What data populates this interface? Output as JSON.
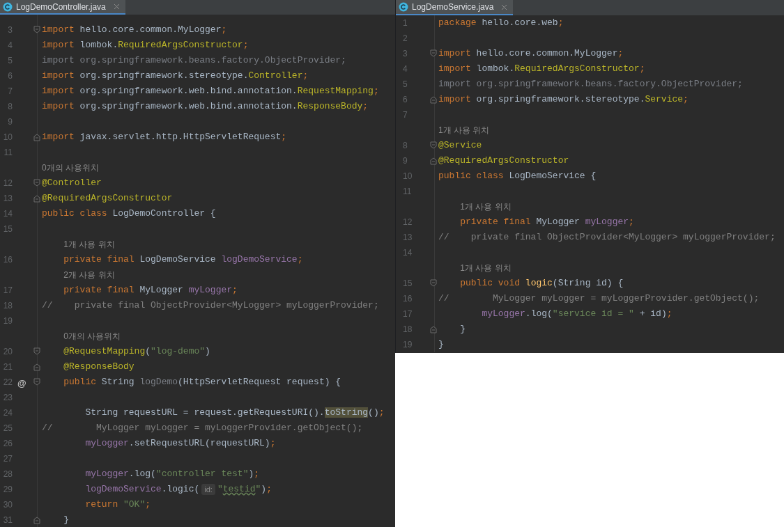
{
  "panes": [
    {
      "tab": {
        "title": "LogDemoController.java",
        "selected": true
      },
      "lines": [
        {
          "number": "3",
          "fold_open": true,
          "tokens": [
            {
              "text": "import",
              "kind": "kw"
            },
            {
              "text": " hello.core.common.MyLogger",
              "kind": "plain"
            },
            {
              "text": ";",
              "kind": "kw"
            }
          ]
        },
        {
          "number": "4",
          "tokens": [
            {
              "text": "import",
              "kind": "kw"
            },
            {
              "text": " lombok.",
              "kind": "plain"
            },
            {
              "text": "RequiredArgsConstructor",
              "kind": "cls"
            },
            {
              "text": ";",
              "kind": "kw"
            }
          ]
        },
        {
          "number": "5",
          "tokens": [
            {
              "text": "import org.springframework.beans.factory.ObjectProvider;",
              "kind": "unused"
            }
          ]
        },
        {
          "number": "6",
          "tokens": [
            {
              "text": "import",
              "kind": "kw"
            },
            {
              "text": " org.springframework.stereotype.",
              "kind": "plain"
            },
            {
              "text": "Controller",
              "kind": "cls"
            },
            {
              "text": ";",
              "kind": "kw"
            }
          ]
        },
        {
          "number": "7",
          "tokens": [
            {
              "text": "import",
              "kind": "kw"
            },
            {
              "text": " org.springframework.web.bind.annotation.",
              "kind": "plain"
            },
            {
              "text": "RequestMapping",
              "kind": "cls"
            },
            {
              "text": ";",
              "kind": "kw"
            }
          ]
        },
        {
          "number": "8",
          "tokens": [
            {
              "text": "import",
              "kind": "kw"
            },
            {
              "text": " org.springframework.web.bind.annotation.",
              "kind": "plain"
            },
            {
              "text": "ResponseBody",
              "kind": "cls"
            },
            {
              "text": ";",
              "kind": "kw"
            }
          ]
        },
        {
          "number": "9"
        },
        {
          "number": "10",
          "fold_close": true,
          "tokens": [
            {
              "text": "import",
              "kind": "kw"
            },
            {
              "text": " javax.servlet.http.HttpServletRequest",
              "kind": "plain"
            },
            {
              "text": ";",
              "kind": "kw"
            }
          ]
        },
        {
          "number": "11"
        },
        {
          "number": "12",
          "usage_hint": "0개의 사용위치",
          "fold_open": true,
          "tokens": [
            {
              "text": "@Controller",
              "kind": "ann"
            }
          ]
        },
        {
          "number": "13",
          "fold_close": true,
          "tokens": [
            {
              "text": "@RequiredArgsConstructor",
              "kind": "ann"
            }
          ]
        },
        {
          "number": "14",
          "tokens": [
            {
              "text": "public class",
              "kind": "kw"
            },
            {
              "text": " LogDemoController {",
              "kind": "plain"
            }
          ]
        },
        {
          "number": "15"
        },
        {
          "number": "16",
          "usage_hint": "1개 사용 위치",
          "tokens": [
            {
              "text": "    private final",
              "kind": "kw"
            },
            {
              "text": " LogDemoService ",
              "kind": "plain"
            },
            {
              "text": "logDemoService",
              "kind": "field"
            },
            {
              "text": ";",
              "kind": "kw"
            }
          ]
        },
        {
          "number": "17",
          "usage_hint": "2개 사용 위치",
          "tokens": [
            {
              "text": "    private final",
              "kind": "kw"
            },
            {
              "text": " MyLogger ",
              "kind": "plain"
            },
            {
              "text": "myLogger",
              "kind": "field"
            },
            {
              "text": ";",
              "kind": "kw"
            }
          ]
        },
        {
          "number": "18",
          "tokens": [
            {
              "text": "//    private final ObjectProvider<MyLogger> myLoggerProvider;",
              "kind": "cmt"
            }
          ]
        },
        {
          "number": "19"
        },
        {
          "number": "20",
          "usage_hint": "0개의 사용위치",
          "fold_open": true,
          "tokens": [
            {
              "text": "    @RequestMapping",
              "kind": "ann"
            },
            {
              "text": "(",
              "kind": "plain"
            },
            {
              "text": "\"log-demo\"",
              "kind": "str"
            },
            {
              "text": ")",
              "kind": "plain"
            }
          ]
        },
        {
          "number": "21",
          "fold_close": true,
          "tokens": [
            {
              "text": "    @ResponseBody",
              "kind": "ann"
            }
          ]
        },
        {
          "number": "22",
          "gutter_mark": "@",
          "fold_open": true,
          "tokens": [
            {
              "text": "    public",
              "kind": "kw"
            },
            {
              "text": " String ",
              "kind": "plain"
            },
            {
              "text": "logDemo",
              "kind": "unused"
            },
            {
              "text": "(HttpServletRequest request) {",
              "kind": "plain"
            }
          ]
        },
        {
          "number": "23"
        },
        {
          "number": "24",
          "tokens": [
            {
              "text": "        String requestURL = request.getRequestURI().",
              "kind": "plain"
            },
            {
              "text": "toString",
              "kind": "highlight"
            },
            {
              "text": "()",
              "kind": "plain"
            },
            {
              "text": ";",
              "kind": "kw"
            }
          ]
        },
        {
          "number": "25",
          "tokens": [
            {
              "text": "//        MyLogger myLogger = myLoggerProvider.getObject();",
              "kind": "cmt"
            }
          ]
        },
        {
          "number": "26",
          "tokens": [
            {
              "text": "        myLogger",
              "kind": "field"
            },
            {
              "text": ".setRequestURL(requestURL)",
              "kind": "plain"
            },
            {
              "text": ";",
              "kind": "kw"
            }
          ]
        },
        {
          "number": "27"
        },
        {
          "number": "28",
          "tokens": [
            {
              "text": "        myLogger",
              "kind": "field"
            },
            {
              "text": ".log(",
              "kind": "plain"
            },
            {
              "text": "\"controller test\"",
              "kind": "str"
            },
            {
              "text": ")",
              "kind": "plain"
            },
            {
              "text": ";",
              "kind": "kw"
            }
          ]
        },
        {
          "number": "29",
          "tokens": [
            {
              "text": "        logDemoService",
              "kind": "field"
            },
            {
              "text": ".logic(",
              "kind": "plain"
            },
            {
              "text": "id:",
              "kind": "inlay"
            },
            {
              "text": "\"",
              "kind": "str"
            },
            {
              "text": "testid",
              "kind": "typo"
            },
            {
              "text": "\"",
              "kind": "str"
            },
            {
              "text": ")",
              "kind": "plain"
            },
            {
              "text": ";",
              "kind": "kw"
            }
          ]
        },
        {
          "number": "30",
          "tokens": [
            {
              "text": "        return",
              "kind": "kw"
            },
            {
              "text": " \"OK\"",
              "kind": "str"
            },
            {
              "text": ";",
              "kind": "kw"
            }
          ]
        },
        {
          "number": "31",
          "fold_close": true,
          "tokens": [
            {
              "text": "    }",
              "kind": "plain"
            }
          ]
        }
      ]
    },
    {
      "tab": {
        "title": "LogDemoService.java",
        "selected": true
      },
      "lines": [
        {
          "number": "1",
          "tokens": [
            {
              "text": "package",
              "kind": "kw"
            },
            {
              "text": " hello.core.web",
              "kind": "plain"
            },
            {
              "text": ";",
              "kind": "kw"
            }
          ]
        },
        {
          "number": "2"
        },
        {
          "number": "3",
          "fold_open": true,
          "tokens": [
            {
              "text": "import",
              "kind": "kw"
            },
            {
              "text": " hello.core.common.MyLogger",
              "kind": "plain"
            },
            {
              "text": ";",
              "kind": "kw"
            }
          ]
        },
        {
          "number": "4",
          "tokens": [
            {
              "text": "import",
              "kind": "kw"
            },
            {
              "text": " lombok.",
              "kind": "plain"
            },
            {
              "text": "RequiredArgsConstructor",
              "kind": "cls"
            },
            {
              "text": ";",
              "kind": "kw"
            }
          ]
        },
        {
          "number": "5",
          "tokens": [
            {
              "text": "import org.springframework.beans.factory.ObjectProvider;",
              "kind": "unused"
            }
          ]
        },
        {
          "number": "6",
          "fold_close": true,
          "tokens": [
            {
              "text": "import",
              "kind": "kw"
            },
            {
              "text": " org.springframework.stereotype.",
              "kind": "plain"
            },
            {
              "text": "Service",
              "kind": "cls"
            },
            {
              "text": ";",
              "kind": "kw"
            }
          ]
        },
        {
          "number": "7"
        },
        {
          "number": "8",
          "usage_hint": "1개 사용 위치",
          "fold_open": true,
          "tokens": [
            {
              "text": "@Service",
              "kind": "ann"
            }
          ]
        },
        {
          "number": "9",
          "fold_close": true,
          "tokens": [
            {
              "text": "@RequiredArgsConstructor",
              "kind": "ann"
            }
          ]
        },
        {
          "number": "10",
          "tokens": [
            {
              "text": "public class",
              "kind": "kw"
            },
            {
              "text": " LogDemoService {",
              "kind": "plain"
            }
          ]
        },
        {
          "number": "11"
        },
        {
          "number": "12",
          "usage_hint": "1개 사용 위치",
          "tokens": [
            {
              "text": "    private final",
              "kind": "kw"
            },
            {
              "text": " MyLogger ",
              "kind": "plain"
            },
            {
              "text": "myLogger",
              "kind": "field"
            },
            {
              "text": ";",
              "kind": "kw"
            }
          ]
        },
        {
          "number": "13",
          "tokens": [
            {
              "text": "//    private final ObjectProvider<MyLogger> myLoggerProvider;",
              "kind": "cmt"
            }
          ]
        },
        {
          "number": "14"
        },
        {
          "number": "15",
          "usage_hint": "1개 사용 위치",
          "fold_open": true,
          "tokens": [
            {
              "text": "    public void",
              "kind": "kw"
            },
            {
              "text": " logic",
              "kind": "decl"
            },
            {
              "text": "(String id) {",
              "kind": "plain"
            }
          ]
        },
        {
          "number": "16",
          "tokens": [
            {
              "text": "//        MyLogger myLogger = myLoggerProvider.getObject();",
              "kind": "cmt"
            }
          ]
        },
        {
          "number": "17",
          "tokens": [
            {
              "text": "        myLogger",
              "kind": "field"
            },
            {
              "text": ".log(",
              "kind": "plain"
            },
            {
              "text": "\"service id = \"",
              "kind": "str"
            },
            {
              "text": " + id)",
              "kind": "plain"
            },
            {
              "text": ";",
              "kind": "kw"
            }
          ]
        },
        {
          "number": "18",
          "fold_close": true,
          "tokens": [
            {
              "text": "    }",
              "kind": "plain"
            }
          ]
        },
        {
          "number": "19",
          "tokens": [
            {
              "text": "}",
              "kind": "plain"
            }
          ]
        }
      ]
    }
  ]
}
